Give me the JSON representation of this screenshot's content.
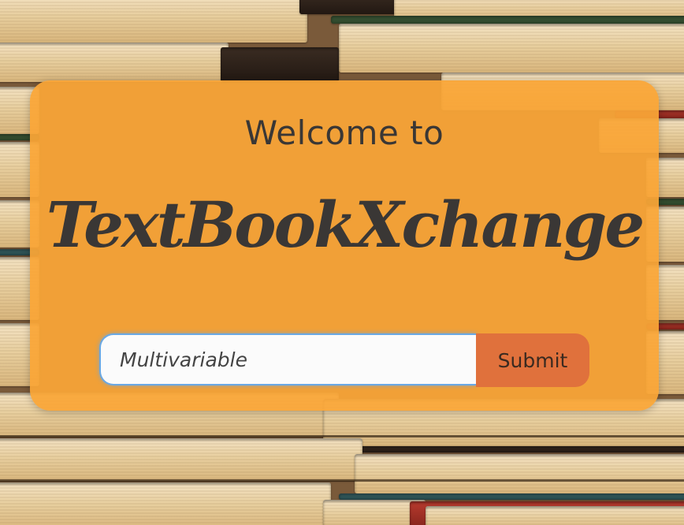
{
  "page": {
    "welcome_text": "Welcome to",
    "brand_name": "TextBookXchange"
  },
  "search": {
    "value": "Multivariable",
    "submit_label": "Submit"
  },
  "colors": {
    "card": "#faa637",
    "submit": "#e0713c",
    "text": "#3a3735",
    "input_focus": "#6aa8e3"
  }
}
